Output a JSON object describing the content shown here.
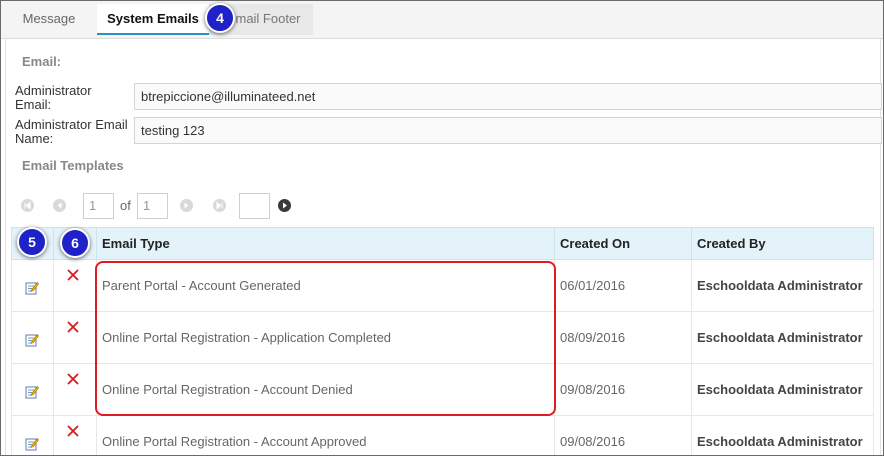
{
  "tabs": [
    {
      "label": "Message"
    },
    {
      "label": "System Emails"
    },
    {
      "label": "mail Footer"
    }
  ],
  "email_section": {
    "title": "Email:",
    "admin_email_label": "Administrator Email:",
    "admin_email_value": "btrepiccione@illuminateed.net",
    "admin_name_label": "Administrator Email Name:",
    "admin_name_value": "testing 123"
  },
  "templates_section": {
    "title": "Email Templates"
  },
  "pager": {
    "current_page": "1",
    "of_label": "of",
    "total_pages": "1",
    "page_size": ""
  },
  "table": {
    "headers": {
      "type": "Email Type",
      "created_on": "Created On",
      "created_by": "Created By"
    },
    "rows": [
      {
        "type": "Parent Portal - Account Generated",
        "created_on": "06/01/2016",
        "created_by": "Eschooldata Administrator"
      },
      {
        "type": "Online Portal Registration - Application Completed",
        "created_on": "08/09/2016",
        "created_by": "Eschooldata Administrator"
      },
      {
        "type": "Online Portal Registration - Account Denied",
        "created_on": "09/08/2016",
        "created_by": "Eschooldata Administrator"
      },
      {
        "type": "Online Portal Registration - Account Approved",
        "created_on": "09/08/2016",
        "created_by": "Eschooldata Administrator"
      }
    ]
  },
  "callouts": {
    "tab": "4",
    "edit": "5",
    "delete": "6"
  },
  "colors": {
    "callout": "#1e22c8",
    "highlight": "#e11b22",
    "header_bg": "#e4f2fa",
    "active_tab_underline": "#2d8fc6"
  },
  "icons": {
    "edit": "edit-note-icon",
    "delete": "delete-x-icon",
    "pager": [
      "first-page-icon",
      "prev-page-icon",
      "next-page-icon",
      "last-page-icon",
      "go-icon"
    ]
  }
}
